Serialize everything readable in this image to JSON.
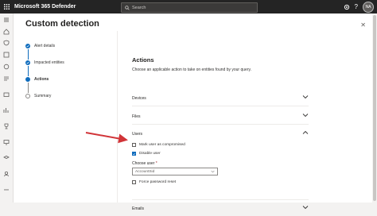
{
  "app": {
    "title": "Microsoft 365 Defender",
    "user_initials": "NA"
  },
  "search": {
    "placeholder": "Search"
  },
  "panel": {
    "title": "Custom detection"
  },
  "wizard": {
    "steps": [
      {
        "label": "Alert details",
        "state": "done"
      },
      {
        "label": "Impacted entities",
        "state": "done"
      },
      {
        "label": "Actions",
        "state": "current"
      },
      {
        "label": "Summary",
        "state": "todo"
      }
    ]
  },
  "actions": {
    "heading": "Actions",
    "description": "Choose an applicable action to take on entities found by your query.",
    "sections": {
      "devices": "Devices",
      "files": "Files",
      "users": "Users",
      "emails": "Emails"
    },
    "users": {
      "mark_compromised": {
        "label": "Mark user as compromised",
        "checked": false
      },
      "disable_user": {
        "label": "Disable user",
        "checked": true
      },
      "choose_user_label": "Choose user",
      "required_mark": "*",
      "choose_user_value": "AccountSid",
      "force_password_reset": {
        "label": "Force password reset",
        "checked": false
      }
    }
  },
  "colors": {
    "accent": "#0f6cbd",
    "topbar": "#242424",
    "arrow": "#d13438"
  }
}
